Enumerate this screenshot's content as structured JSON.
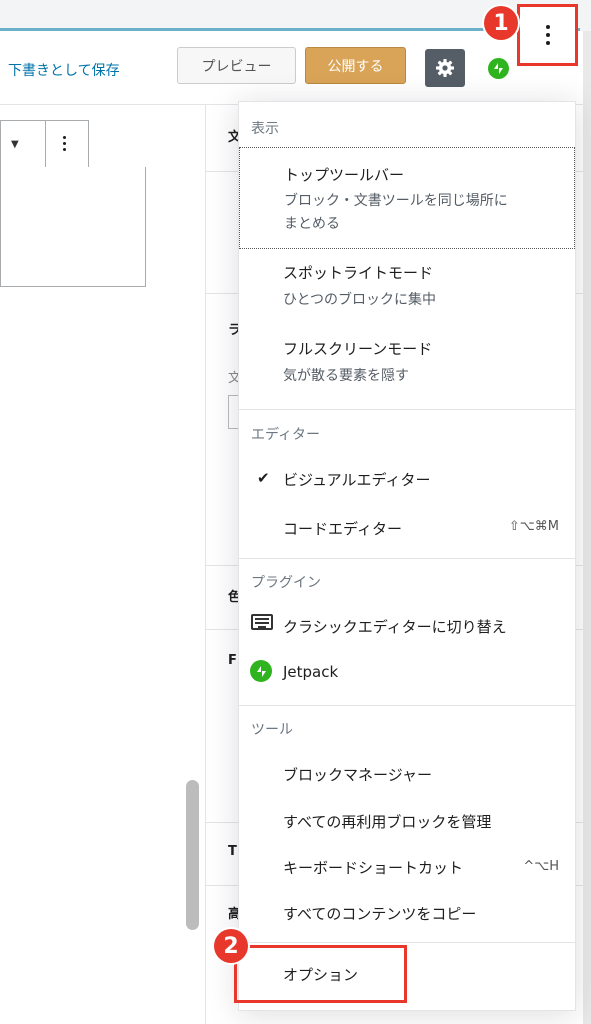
{
  "header": {
    "save_draft_label": "下書きとして保存",
    "preview_label": "プレビュー",
    "publish_label": "公開する",
    "settings_icon": "gear-icon",
    "jetpack_icon": "jetpack-icon",
    "more_icon": "more-vertical-icon"
  },
  "callouts": {
    "one": "1",
    "two": "2"
  },
  "sidebar_peek": {
    "p1": "文",
    "p2": "ラ",
    "p3": "文",
    "p4": "色",
    "p5": "F",
    "p6": "T",
    "p7": "高"
  },
  "menu": {
    "view": {
      "title": "表示",
      "top_toolbar_label": "トップツールバー",
      "top_toolbar_desc_1": "ブロック・文書ツールを同じ場所に",
      "top_toolbar_desc_2": "まとめる",
      "spotlight_label": "スポットライトモード",
      "spotlight_desc": "ひとつのブロックに集中",
      "fullscreen_label": "フルスクリーンモード",
      "fullscreen_desc": "気が散る要素を隠す"
    },
    "editor": {
      "title": "エディター",
      "check_mark": "✔",
      "visual_label": "ビジュアルエディター",
      "code_label": "コードエディター",
      "code_shortcut": "⇧⌥⌘M"
    },
    "plugins": {
      "title": "プラグイン",
      "classic_label": "クラシックエディターに切り替え",
      "jetpack_label": "Jetpack"
    },
    "tools": {
      "title": "ツール",
      "block_manager_label": "ブロックマネージャー",
      "reusable_label": "すべての再利用ブロックを管理",
      "shortcuts_label": "キーボードショートカット",
      "shortcuts_shortcut": "^⌥H",
      "copy_all_label": "すべてのコンテンツをコピー"
    },
    "options_label": "オプション"
  }
}
